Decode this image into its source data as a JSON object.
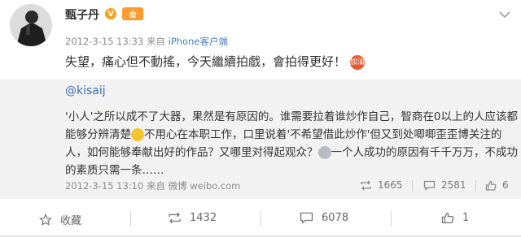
{
  "post": {
    "username": "甄子丹",
    "verified_mark": "V",
    "vip_mark": "会",
    "timestamp": "2012-3-15 13:33",
    "from_label": "来自",
    "source": "iPhone客户端",
    "text": "失望，痛心但不動搖，今天繼續拍戲，會拍得更好！",
    "emoji_label": "加油"
  },
  "repost": {
    "user": "@kisaij",
    "lines": [
      "'小人'之所以成不了大器，果然是有原因的。谁需要拉着谁炒作自己，智商在0以上的人应该都",
      "能够分辨清楚",
      "不用心在本职工作，口里说着'不希望借此炒作'但又到处唧唧歪歪博关注的",
      "人，如何能够奉献出好的作品？又哪里对得起观众？",
      "一个人成功的原因有千千万万，不成功",
      "的素质只需一条……"
    ],
    "timestamp": "2012-3-15 13:10",
    "from_label": "来自",
    "source": "微博 weibo.com",
    "reposts": "1665",
    "comments": "2581",
    "likes": "6"
  },
  "actions": {
    "favorite": "收藏",
    "repost": "1432",
    "comment": "6078",
    "like": "1"
  },
  "icons": {
    "chevron": "chevron-down-icon",
    "favorite": "star-icon",
    "repost": "repost-icon",
    "comment": "comment-icon",
    "like": "thumbs-up-icon"
  },
  "colors": {
    "link": "#3d6fb4",
    "source": "#4a7dbe",
    "meta": "#8c8c8c",
    "repost_bg": "#f2f2f2",
    "verified": "#f7a21b"
  }
}
